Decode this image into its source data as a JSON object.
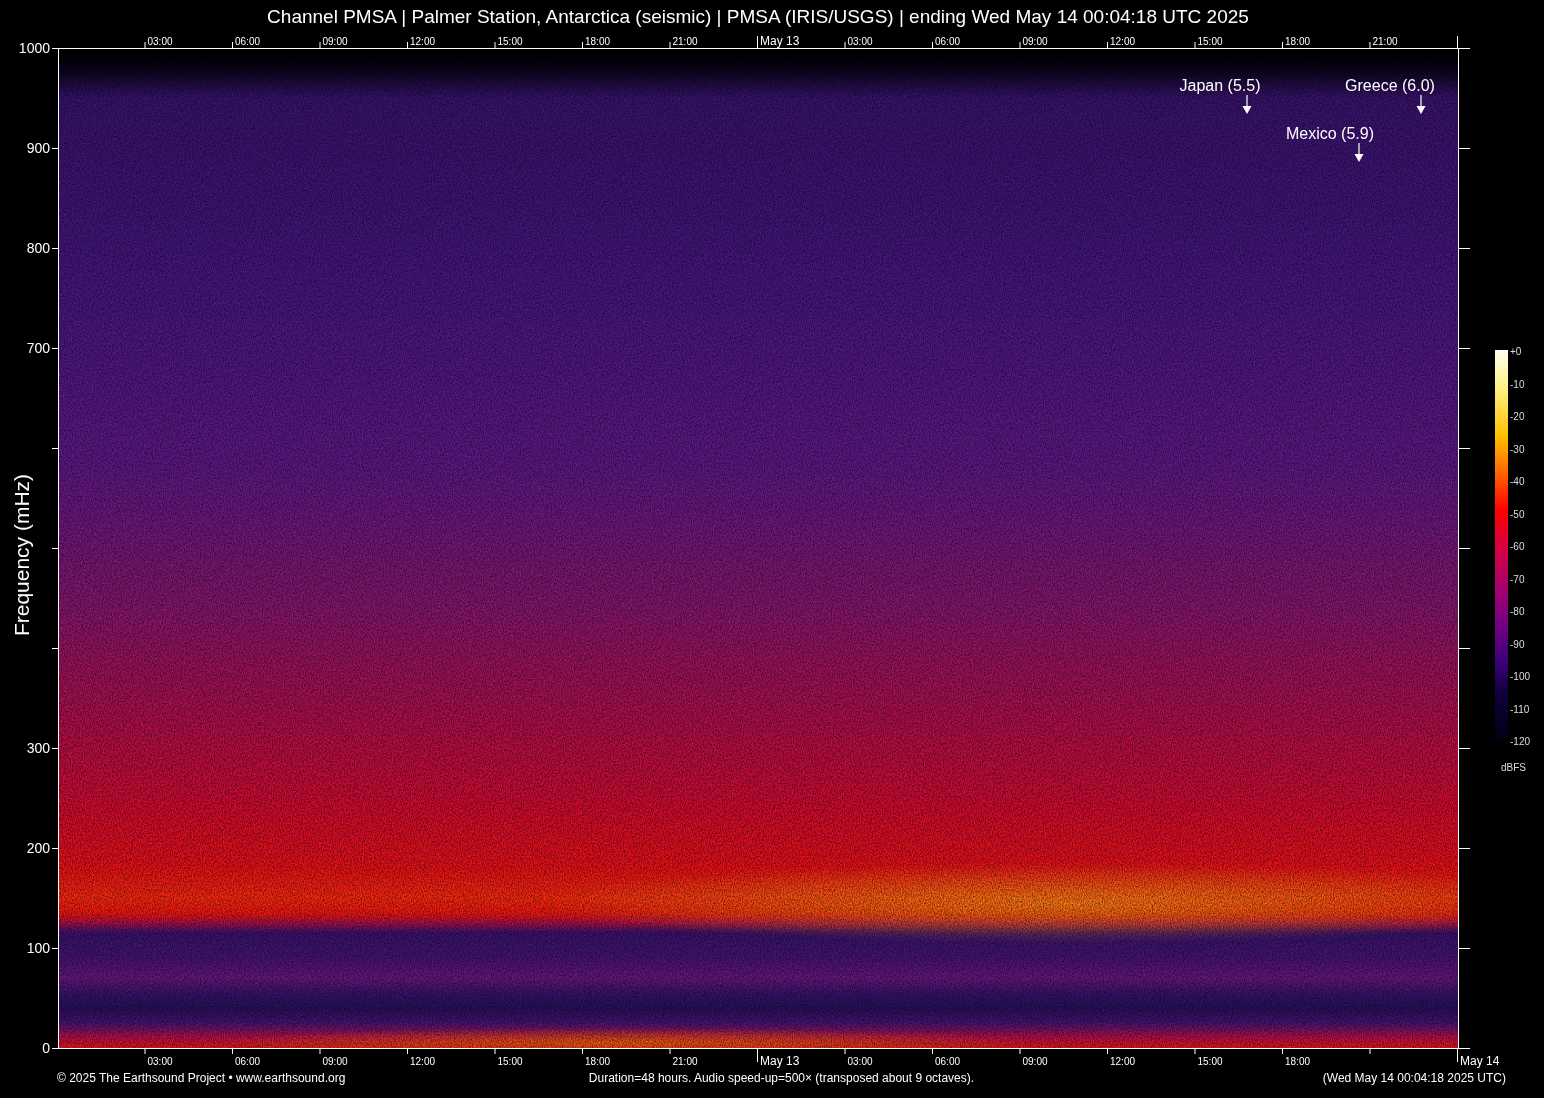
{
  "title": "Channel PMSA | Palmer Station, Antarctica (seismic) | PMSA (IRIS/USGS) | ending Wed May 14 00:04:18 UTC 2025",
  "y_axis": {
    "label": "Frequency (mHz)",
    "tick_labels": [
      "1000",
      "900",
      "800",
      "700",
      "300",
      "200",
      "100",
      "0"
    ]
  },
  "top_time_labels": [
    "03:00",
    "06:00",
    "09:00",
    "12:00",
    "15:00",
    "18:00",
    "21:00",
    "May 13",
    "03:00",
    "06:00",
    "09:00",
    "12:00",
    "15:00",
    "18:00",
    "21:00"
  ],
  "bottom_time_labels": [
    "03:00",
    "06:00",
    "09:00",
    "12:00",
    "15:00",
    "18:00",
    "21:00",
    "May 13",
    "03:00",
    "06:00",
    "09:00",
    "12:00",
    "15:00",
    "18:00",
    "May 14"
  ],
  "events": [
    {
      "label": "Japan (5.5)"
    },
    {
      "label": "Greece (6.0)"
    },
    {
      "label": "Mexico (5.9)"
    }
  ],
  "colorbar": {
    "tick_labels": [
      "+0",
      "-10",
      "-20",
      "-30",
      "-40",
      "-50",
      "-60",
      "-70",
      "-80",
      "-90",
      "-100",
      "-110",
      "-120"
    ],
    "unit": "dBFS"
  },
  "footer": {
    "credit": "© 2025 The Earthsound Project • www.earthsound.org",
    "info": "Duration=48 hours. Audio speed-up=500× (transposed about 9 octaves).",
    "timestamp": "(Wed May 14 00:04:18 2025 UTC)"
  }
}
